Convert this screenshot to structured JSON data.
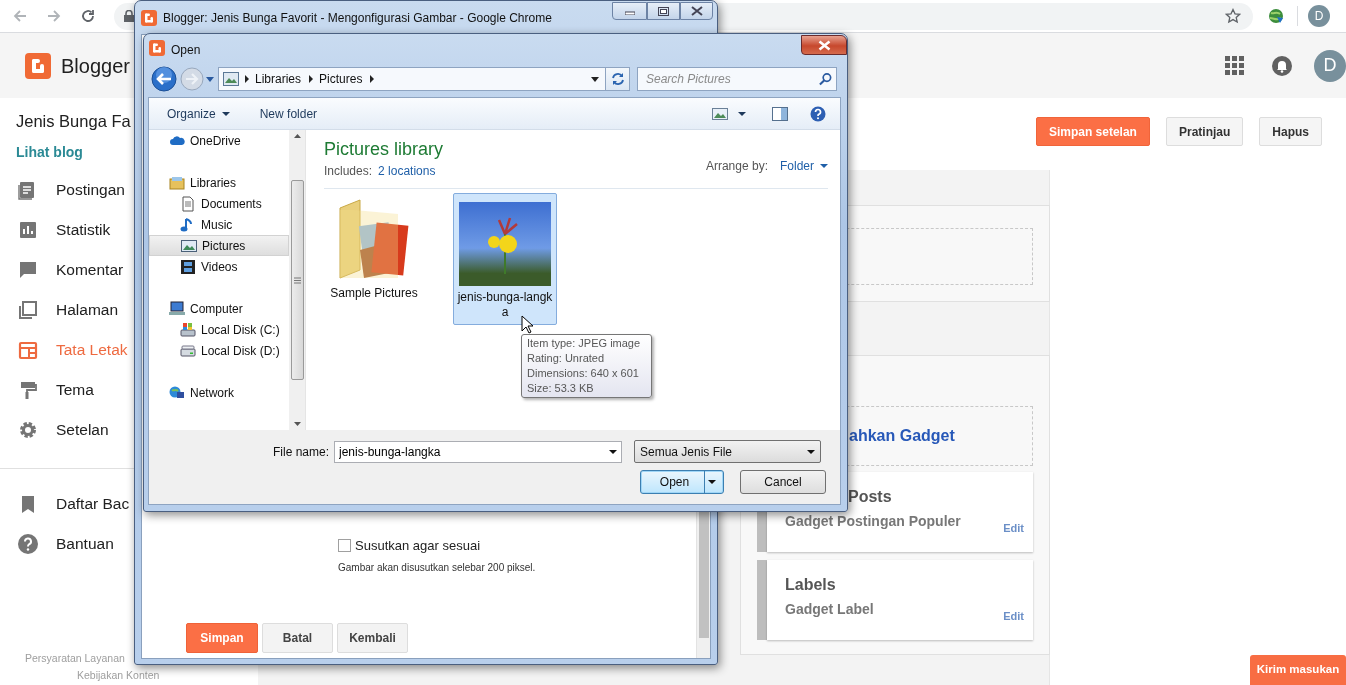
{
  "browser": {
    "profile_initial": "D"
  },
  "blogger": {
    "brand": "Blogger",
    "account_initial": "D",
    "blog_title": "Jenis Bunga Fa",
    "view_blog_link": "Lihat blog",
    "actions": [
      {
        "label": "Simpan setelan",
        "kind": "primary"
      },
      {
        "label": "Pratinjau",
        "kind": "default"
      },
      {
        "label": "Hapus",
        "kind": "default"
      }
    ],
    "nav": [
      {
        "label": "Postingan",
        "selected": false
      },
      {
        "label": "Statistik",
        "selected": false
      },
      {
        "label": "Komentar",
        "selected": false
      },
      {
        "label": "Halaman",
        "selected": false
      },
      {
        "label": "Tata Letak",
        "selected": true
      },
      {
        "label": "Tema",
        "selected": false
      },
      {
        "label": "Setelan",
        "selected": false
      }
    ],
    "nav_secondary": [
      "Daftar Bac",
      "Bantuan"
    ],
    "footer_links": [
      "Persyaratan Layanan",
      "Kebijakan Konten"
    ],
    "layout": {
      "add_gadget": "ahkan Gadget",
      "gadgets": [
        {
          "title": "Posts",
          "description": "Gadget Postingan Populer",
          "action": "Edit"
        },
        {
          "title": "Labels",
          "description": "Gadget Label",
          "action": "Edit"
        }
      ]
    },
    "feedback_button": "Kirim masukan"
  },
  "popup_window": {
    "title": "Blogger: Jenis Bunga Favorit - Mengonfigurasi Gambar - Google Chrome",
    "shrink_option": {
      "label": "Susutkan agar sesuai",
      "checked": false
    },
    "note": "Gambar akan disusutkan selebar 200 piksel.",
    "buttons": [
      {
        "label": "Simpan",
        "kind": "primary"
      },
      {
        "label": "Batal",
        "kind": "default"
      },
      {
        "label": "Kembali",
        "kind": "default"
      }
    ]
  },
  "open_dialog": {
    "title": "Open",
    "breadcrumb": [
      "Libraries",
      "Pictures"
    ],
    "search": {
      "placeholder": "Search Pictures"
    },
    "toolbar": [
      {
        "label": "Organize",
        "menu": true
      },
      {
        "label": "New folder",
        "menu": false
      }
    ],
    "nav_tree": [
      {
        "label": "OneDrive",
        "selected": false
      },
      {
        "label": "Libraries",
        "selected": false,
        "children": [
          {
            "label": "Documents",
            "selected": false
          },
          {
            "label": "Music",
            "selected": false
          },
          {
            "label": "Pictures",
            "selected": true
          },
          {
            "label": "Videos",
            "selected": false
          }
        ]
      },
      {
        "label": "Computer",
        "selected": false,
        "children": [
          {
            "label": "Local Disk (C:)",
            "selected": false
          },
          {
            "label": "Local Disk (D:)",
            "selected": false
          }
        ]
      },
      {
        "label": "Network",
        "selected": false
      }
    ],
    "library": {
      "title": "Pictures library",
      "includes_label": "Includes:",
      "includes_link": "2 locations",
      "arrange_label": "Arrange by:",
      "arrange_value": "Folder"
    },
    "items": [
      {
        "label": "Sample Pictures",
        "kind": "folder",
        "selected": false
      },
      {
        "label": "jenis-bunga-langka",
        "kind": "image",
        "selected": true
      }
    ],
    "tooltip": [
      "Item type: JPEG image",
      "Rating: Unrated",
      "Dimensions: 640 x 601",
      "Size: 53.3 KB"
    ],
    "file_name": {
      "label": "File name:",
      "value": "jenis-bunga-langka"
    },
    "file_type": "Semua Jenis File",
    "buttons": [
      {
        "label": "Open",
        "kind": "split"
      },
      {
        "label": "Cancel",
        "kind": "default"
      }
    ]
  }
}
